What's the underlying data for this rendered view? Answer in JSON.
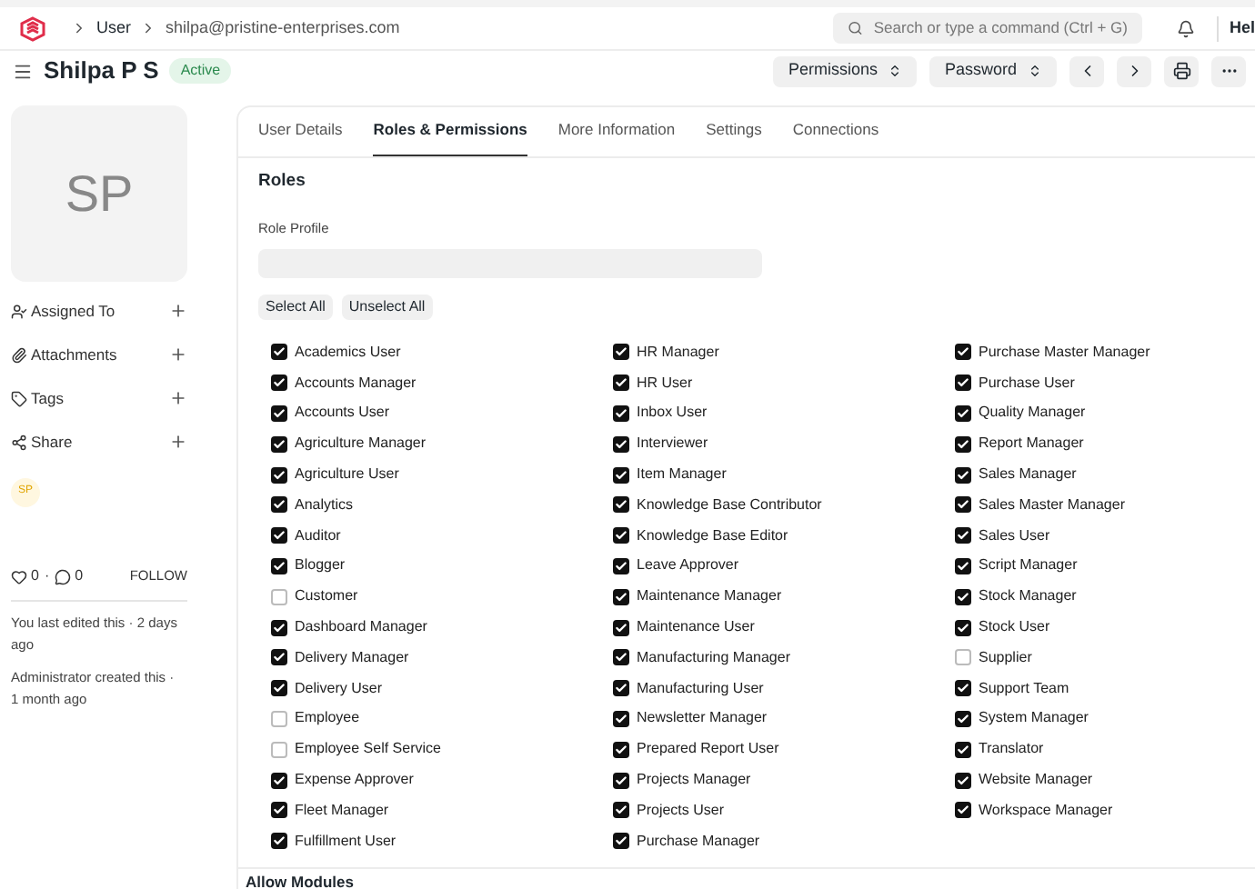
{
  "navbar": {
    "breadcrumbs": [
      "User",
      "shilpa@pristine-enterprises.com"
    ],
    "search": {
      "placeholder": "Search or type a command (Ctrl + G)"
    },
    "help": "Hel"
  },
  "header": {
    "title": "Shilpa P S",
    "status": "Active",
    "buttons": [
      {
        "kind": "dropdown",
        "label": "Permissions"
      },
      {
        "kind": "dropdown",
        "label": "Password"
      },
      {
        "kind": "prev"
      },
      {
        "kind": "next"
      },
      {
        "kind": "print"
      },
      {
        "kind": "more"
      }
    ]
  },
  "sidebar": {
    "avatar": "SP",
    "items": [
      {
        "kind": "assign",
        "label": "Assigned To"
      },
      {
        "kind": "attach",
        "label": "Attachments"
      },
      {
        "kind": "tag",
        "label": "Tags"
      },
      {
        "kind": "share",
        "label": "Share"
      }
    ],
    "shared_with": "SP",
    "likes": "0",
    "separator": "·",
    "comments": "0",
    "follow": "FOLLOW",
    "activity": [
      "You last edited this · 2 days ago",
      "Administrator created this · 1 month ago"
    ]
  },
  "tabs": [
    {
      "label": "User Details",
      "selected": false
    },
    {
      "label": "Roles & Permissions",
      "selected": true
    },
    {
      "label": "More Information",
      "selected": false
    },
    {
      "label": "Settings",
      "selected": false
    },
    {
      "label": "Connections",
      "selected": false
    }
  ],
  "section": {
    "title": "Roles",
    "role_profile_label": "Role Profile",
    "actions": [
      "Select All",
      "Unselect All"
    ],
    "roles": [
      {
        "label": "Academics User",
        "checked": true
      },
      {
        "label": "Accounts Manager",
        "checked": true
      },
      {
        "label": "Accounts User",
        "checked": true
      },
      {
        "label": "Agriculture Manager",
        "checked": true
      },
      {
        "label": "Agriculture User",
        "checked": true
      },
      {
        "label": "Analytics",
        "checked": true
      },
      {
        "label": "Auditor",
        "checked": true
      },
      {
        "label": "Blogger",
        "checked": true
      },
      {
        "label": "Customer",
        "checked": false
      },
      {
        "label": "Dashboard Manager",
        "checked": true
      },
      {
        "label": "Delivery Manager",
        "checked": true
      },
      {
        "label": "Delivery User",
        "checked": true
      },
      {
        "label": "Employee",
        "checked": false
      },
      {
        "label": "Employee Self Service",
        "checked": false
      },
      {
        "label": "Expense Approver",
        "checked": true
      },
      {
        "label": "Fleet Manager",
        "checked": true
      },
      {
        "label": "Fulfillment User",
        "checked": true
      },
      {
        "label": "HR Manager",
        "checked": true
      },
      {
        "label": "HR User",
        "checked": true
      },
      {
        "label": "Inbox User",
        "checked": true
      },
      {
        "label": "Interviewer",
        "checked": true
      },
      {
        "label": "Item Manager",
        "checked": true
      },
      {
        "label": "Knowledge Base Contributor",
        "checked": true
      },
      {
        "label": "Knowledge Base Editor",
        "checked": true
      },
      {
        "label": "Leave Approver",
        "checked": true
      },
      {
        "label": "Maintenance Manager",
        "checked": true
      },
      {
        "label": "Maintenance User",
        "checked": true
      },
      {
        "label": "Manufacturing Manager",
        "checked": true
      },
      {
        "label": "Manufacturing User",
        "checked": true
      },
      {
        "label": "Newsletter Manager",
        "checked": true
      },
      {
        "label": "Prepared Report User",
        "checked": true
      },
      {
        "label": "Projects Manager",
        "checked": true
      },
      {
        "label": "Projects User",
        "checked": true
      },
      {
        "label": "Purchase Manager",
        "checked": true
      },
      {
        "label": "Purchase Master Manager",
        "checked": true
      },
      {
        "label": "Purchase User",
        "checked": true
      },
      {
        "label": "Quality Manager",
        "checked": true
      },
      {
        "label": "Report Manager",
        "checked": true
      },
      {
        "label": "Sales Manager",
        "checked": true
      },
      {
        "label": "Sales Master Manager",
        "checked": true
      },
      {
        "label": "Sales User",
        "checked": true
      },
      {
        "label": "Script Manager",
        "checked": true
      },
      {
        "label": "Stock Manager",
        "checked": true
      },
      {
        "label": "Stock User",
        "checked": true
      },
      {
        "label": "Supplier",
        "checked": false
      },
      {
        "label": "Support Team",
        "checked": true
      },
      {
        "label": "System Manager",
        "checked": true
      },
      {
        "label": "Translator",
        "checked": true
      },
      {
        "label": "Website Manager",
        "checked": true
      },
      {
        "label": "Workspace Manager",
        "checked": true
      }
    ]
  },
  "next_section": {
    "title": "Allow Modules"
  }
}
